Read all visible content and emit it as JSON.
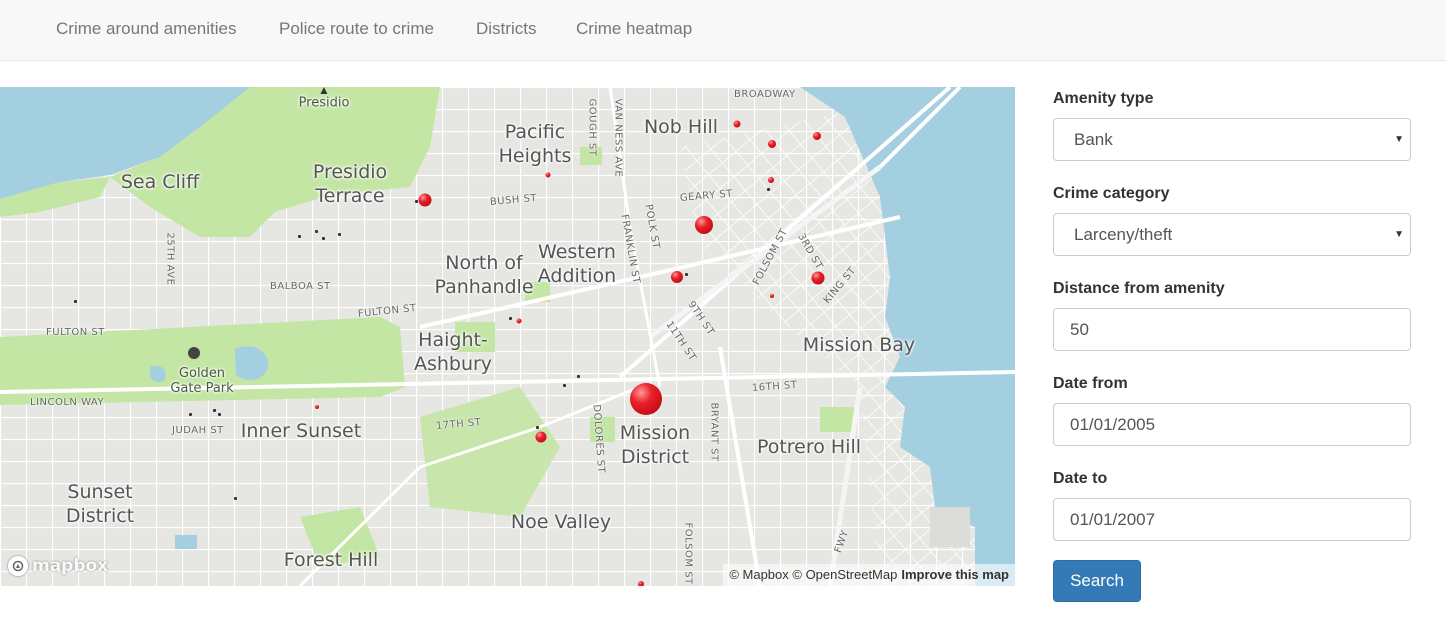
{
  "nav": {
    "items": [
      "Crime around amenities",
      "Police route to crime",
      "Districts",
      "Crime heatmap"
    ]
  },
  "map": {
    "neighborhoods": {
      "presidio": "Presidio",
      "sea_cliff": "Sea Cliff",
      "presidio_terrace": "Presidio\nTerrace",
      "pacific_heights": "Pacific\nHeights",
      "nob_hill": "Nob Hill",
      "western_addition": "Western\nAddition",
      "north_of_panhandle": "North of\nPanhandle",
      "haight_ashbury": "Haight-\nAshbury",
      "golden_gate_park": "Golden\nGate Park",
      "inner_sunset": "Inner Sunset",
      "mission_district": "Mission\nDistrict",
      "mission_bay": "Mission Bay",
      "potrero_hill": "Potrero Hill",
      "sunset_district": "Sunset\nDistrict",
      "noe_valley": "Noe Valley",
      "forest_hill": "Forest Hill"
    },
    "streets": {
      "broadway": "BROADWAY",
      "gough": "GOUGH ST",
      "van_ness": "VAN NESS AVE",
      "bush": "BUSH ST",
      "geary": "GEARY ST",
      "franklin": "FRANKLIN ST",
      "polk": "POLK ST",
      "ave25": "25TH AVE",
      "balboa": "BALBOA ST",
      "fulton": "FULTON ST",
      "fulton2": "FULTON ST",
      "lincoln": "LINCOLN WAY",
      "judah": "JUDAH ST",
      "st17": "17TH ST",
      "dolores": "DOLORES ST",
      "bryant": "BRYANT ST",
      "st16": "16TH ST",
      "folsom": "FOLSOM ST",
      "folsom2": "FOLSOM ST",
      "st9": "9TH ST",
      "st11": "11TH ST",
      "st3": "3RD ST",
      "king": "KING ST",
      "fwy": "FWY"
    },
    "logo": "mapbox",
    "attribution": "© Mapbox © OpenStreetMap",
    "improve": "Improve this map",
    "colors": {
      "water": "#a3cfe0",
      "park": "#c4e6a5",
      "marker": "#e8202a"
    }
  },
  "form": {
    "amenity_label": "Amenity type",
    "amenity_value": "Bank",
    "crime_label": "Crime category",
    "crime_value": "Larceny/theft",
    "distance_label": "Distance from amenity",
    "distance_value": "50",
    "date_from_label": "Date from",
    "date_from_value": "01/01/2005",
    "date_to_label": "Date to",
    "date_to_value": "01/01/2007",
    "search_label": "Search",
    "accent": "#337ab7"
  }
}
